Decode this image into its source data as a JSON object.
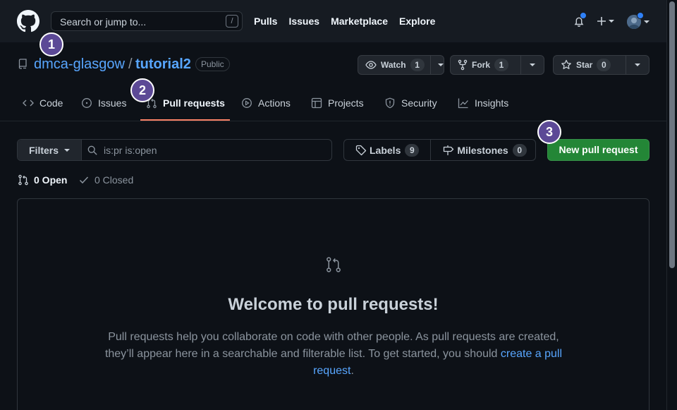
{
  "header": {
    "search_placeholder": "Search or jump to...",
    "search_shortcut": "/",
    "nav": [
      "Pulls",
      "Issues",
      "Marketplace",
      "Explore"
    ]
  },
  "repo": {
    "owner": "dmca-glasgow",
    "separator": "/",
    "name": "tutorial2",
    "visibility": "Public",
    "watch": {
      "label": "Watch",
      "count": "1"
    },
    "fork": {
      "label": "Fork",
      "count": "1"
    },
    "star": {
      "label": "Star",
      "count": "0"
    }
  },
  "tabs": [
    {
      "label": "Code",
      "icon": "code-icon"
    },
    {
      "label": "Issues",
      "icon": "issue-icon"
    },
    {
      "label": "Pull requests",
      "icon": "pull-request-icon",
      "active": true
    },
    {
      "label": "Actions",
      "icon": "play-icon"
    },
    {
      "label": "Projects",
      "icon": "table-icon"
    },
    {
      "label": "Security",
      "icon": "shield-icon"
    },
    {
      "label": "Insights",
      "icon": "graph-icon"
    }
  ],
  "toolbar": {
    "filters_label": "Filters",
    "query": "is:pr is:open",
    "labels_label": "Labels",
    "labels_count": "9",
    "milestones_label": "Milestones",
    "milestones_count": "0",
    "new_pr_label": "New pull request"
  },
  "states": {
    "open": "0 Open",
    "closed": "0 Closed"
  },
  "blankslate": {
    "title": "Welcome to pull requests!",
    "text": "Pull requests help you collaborate on code with other people. As pull requests are created, they’ll appear here in a searchable and filterable list. To get started, you should ",
    "link": "create a pull request",
    "end": "."
  },
  "annotations": [
    "1",
    "2",
    "3"
  ],
  "colors": {
    "background": "#0d1117",
    "header": "#161b22",
    "link": "#58a6ff",
    "primary_button": "#238636",
    "tab_underline": "#f78166",
    "annotation_badge": "#5c4996",
    "notification_dot": "#2f81f7"
  }
}
